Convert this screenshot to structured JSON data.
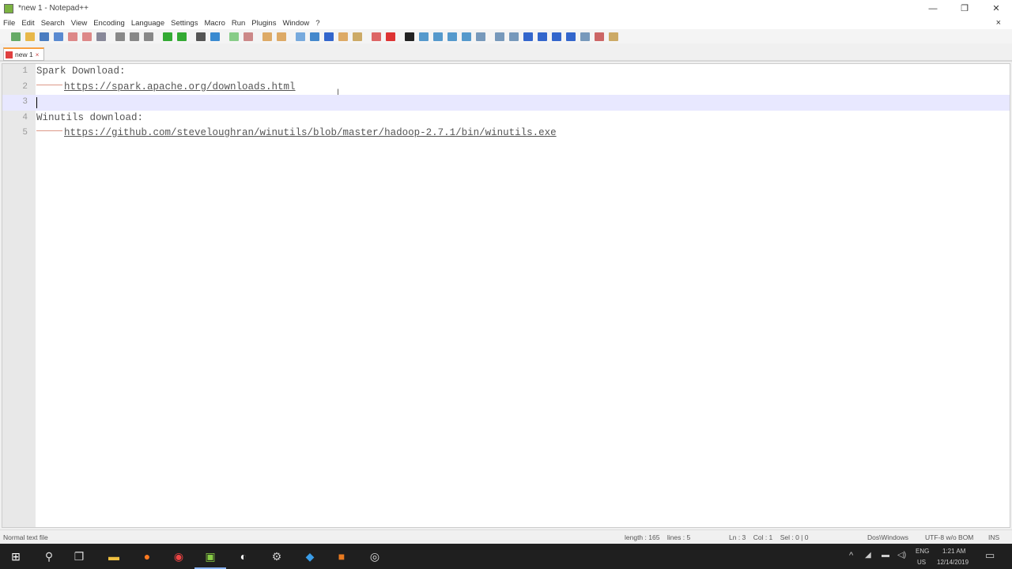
{
  "window": {
    "title": "*new 1 - Notepad++",
    "minimize": "—",
    "maximize": "❐",
    "close": "✕"
  },
  "menu": [
    "File",
    "Edit",
    "Search",
    "View",
    "Encoding",
    "Language",
    "Settings",
    "Macro",
    "Run",
    "Plugins",
    "Window",
    "?"
  ],
  "menu_close_doc": "×",
  "toolbar_colors": [
    "#6a6",
    "#e8b84a",
    "#4a7cc0",
    "#5a8ad0",
    "#d88",
    "#d88",
    "#889",
    "#888",
    "#888",
    "#888",
    "#3a3",
    "#3a3",
    "#555",
    "#3a8ad0",
    "#8c8",
    "#c88",
    "#da6",
    "#da6",
    "#7ad",
    "#48c",
    "#36c",
    "#da6",
    "#ca6",
    "#d66",
    "#d33",
    "#222",
    "#59c",
    "#59c",
    "#59c",
    "#59c",
    "#79b",
    "#79b",
    "#79b",
    "#36c",
    "#36c",
    "#36c",
    "#36c",
    "#79b",
    "#c66",
    "#ca6"
  ],
  "tab": {
    "label": "new 1",
    "close": "×"
  },
  "editor": {
    "lines": [
      {
        "num": "1",
        "text": "Spark Download:",
        "indent": false,
        "url": false
      },
      {
        "num": "2",
        "text": "https://spark.apache.org/downloads.html",
        "indent": true,
        "url": true
      },
      {
        "num": "3",
        "text": "",
        "indent": false,
        "url": false,
        "current": true
      },
      {
        "num": "4",
        "text": "Winutils download:",
        "indent": false,
        "url": false
      },
      {
        "num": "5",
        "text": "https://github.com/steveloughran/winutils/blob/master/hadoop-2.7.1/bin/winutils.exe",
        "indent": true,
        "url": true
      }
    ]
  },
  "status": {
    "file_type": "Normal text file",
    "length": "length : 165    lines : 5",
    "position": "Ln : 3    Col : 1    Sel : 0 | 0",
    "eol": "Dos\\Windows",
    "encoding": "UTF-8 w/o BOM",
    "mode": "INS"
  },
  "taskbar": {
    "apps": [
      {
        "name": "start",
        "glyph": "⊞",
        "color": "#fff"
      },
      {
        "name": "search",
        "glyph": "⚲",
        "color": "#ddd"
      },
      {
        "name": "task-view",
        "glyph": "❐",
        "color": "#ddd"
      },
      {
        "name": "file-explorer",
        "glyph": "▬",
        "color": "#f0c040"
      },
      {
        "name": "firefox",
        "glyph": "●",
        "color": "#ff7a20"
      },
      {
        "name": "chrome",
        "glyph": "◉",
        "color": "#e44"
      },
      {
        "name": "notepad-plus-plus",
        "glyph": "▣",
        "color": "#8c4",
        "active": true
      },
      {
        "name": "app-u",
        "glyph": "◐",
        "color": "#fff"
      },
      {
        "name": "app-gear",
        "glyph": "⚙",
        "color": "#ccc"
      },
      {
        "name": "vscode",
        "glyph": "◆",
        "color": "#3a9de8"
      },
      {
        "name": "app-orange",
        "glyph": "■",
        "color": "#e87a20"
      },
      {
        "name": "app-circle",
        "glyph": "◎",
        "color": "#ddd"
      }
    ],
    "lang": "ENG",
    "region": "US",
    "time": "1:21 AM",
    "date": "12/14/2019"
  }
}
